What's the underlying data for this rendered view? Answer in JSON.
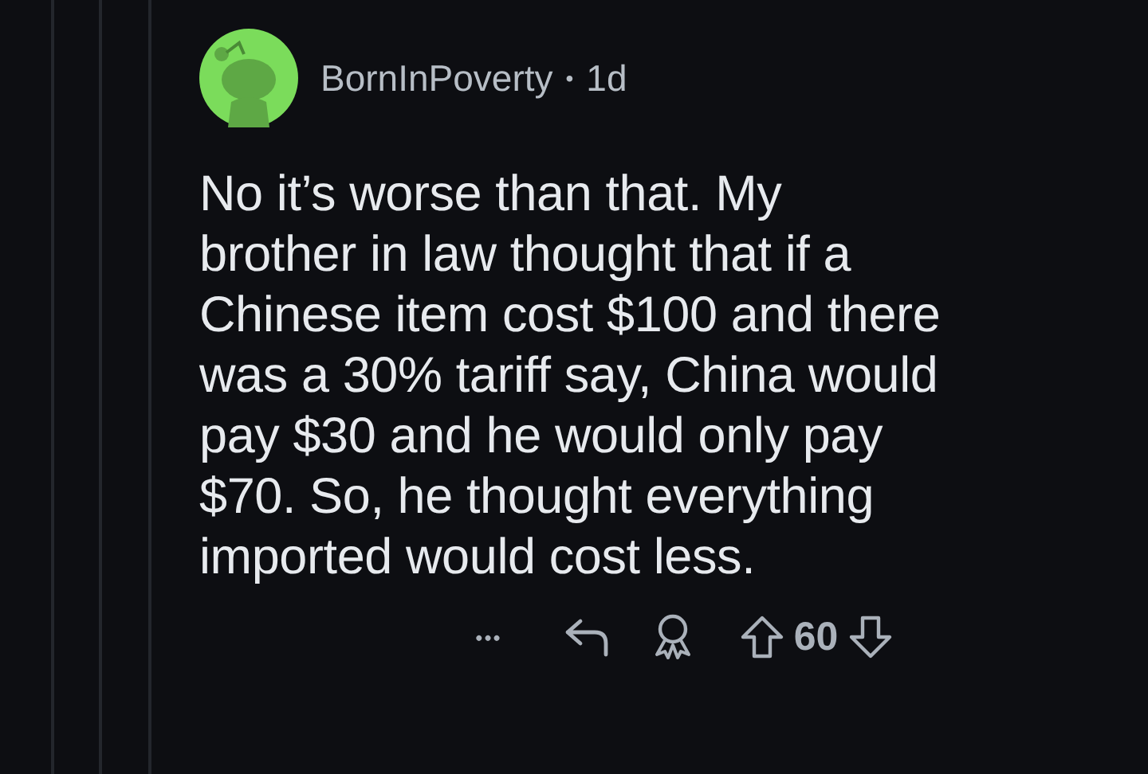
{
  "comment": {
    "author": "BornInPoverty",
    "separator": "•",
    "age": "1d",
    "body_lines": [
      "No it’s worse than that. My",
      "brother in law thought that if a",
      "Chinese item cost $100 and there",
      "was a 30% tariff say, China would",
      "pay $30 and he would only pay",
      "$70. So, he thought everything",
      "imported would cost less."
    ],
    "more": "•••",
    "score": "60"
  }
}
